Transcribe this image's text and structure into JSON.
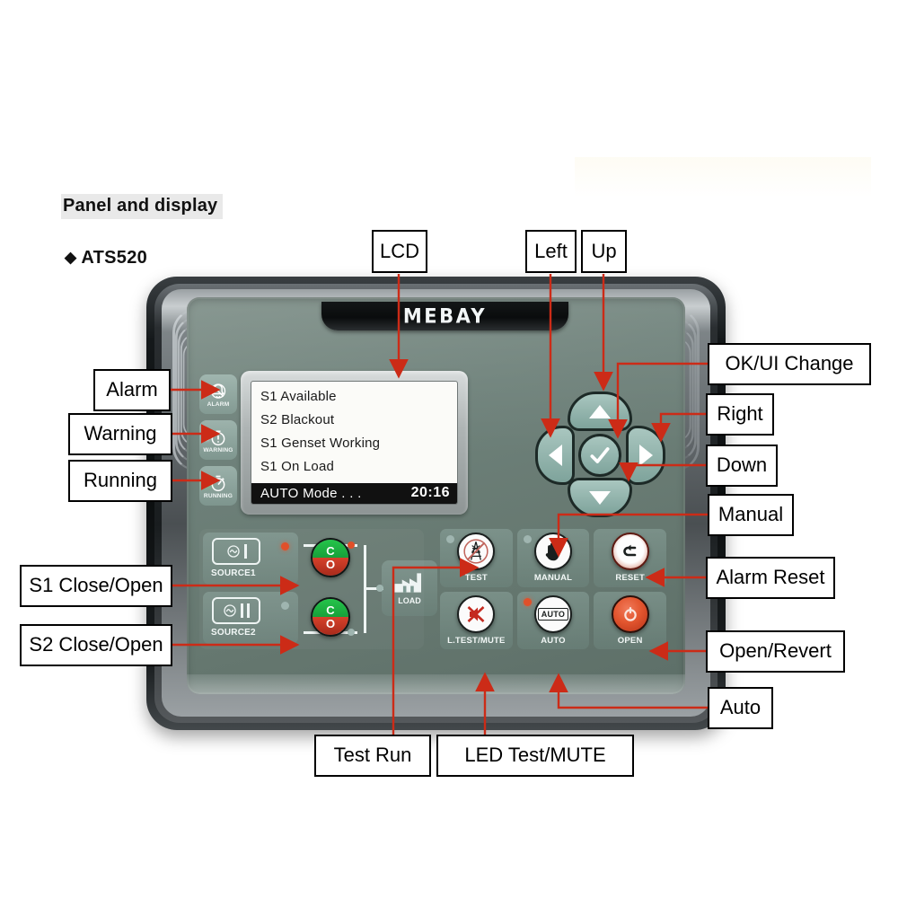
{
  "page": {
    "section_title": "Panel and display",
    "model_bullet": "◆",
    "model_name": "ATS520"
  },
  "device": {
    "brand": "MEBAY",
    "lcd": {
      "lines": [
        "S1 Available",
        "S2 Blackout",
        "S1 Genset Working",
        "S1 On Load"
      ],
      "status_mode": "AUTO Mode . . .",
      "status_time": "20:16"
    },
    "indicators": [
      {
        "label": "ALARM",
        "icon": "alarm-bell-slash-icon",
        "state": "off"
      },
      {
        "label": "WARNING",
        "icon": "warning-exclamation-icon",
        "state": "off"
      },
      {
        "label": "RUNNING",
        "icon": "running-timer-icon",
        "state": "on"
      }
    ],
    "navpad": {
      "up": "▲",
      "down": "▼",
      "left": "◀",
      "right": "▶",
      "ok": "✓"
    },
    "sources": [
      {
        "label": "SOURCE1",
        "symbol": "ac-source-one-icon",
        "led": "red",
        "close_label": "C",
        "open_label": "O"
      },
      {
        "label": "SOURCE2",
        "symbol": "ac-source-two-icon",
        "led": "off",
        "close_label": "C",
        "open_label": "O"
      }
    ],
    "load": {
      "label": "LOAD",
      "icon": "factory-load-icon"
    },
    "buttons": [
      {
        "label": "TEST",
        "icon": "power-tower-slash-icon",
        "indicator": "off",
        "style": "white"
      },
      {
        "label": "MANUAL",
        "icon": "hand-icon",
        "indicator": "off",
        "style": "white"
      },
      {
        "label": "RESET",
        "icon": "return-arrow-icon",
        "indicator": "none",
        "style": "reset"
      },
      {
        "label": "L.TEST/MUTE",
        "icon": "speaker-mute-icon",
        "indicator": "none",
        "style": "white"
      },
      {
        "label": "AUTO",
        "icon": "auto-box-icon",
        "indicator": "red",
        "style": "white"
      },
      {
        "label": "OPEN",
        "icon": "open-power-icon",
        "indicator": "none",
        "style": "open"
      }
    ]
  },
  "callouts": {
    "lcd": "LCD",
    "left": "Left",
    "up": "Up",
    "ok_ui_change": "OK/UI Change",
    "right": "Right",
    "down": "Down",
    "manual": "Manual",
    "alarm_reset": "Alarm Reset",
    "open_revert": "Open/Revert",
    "auto": "Auto",
    "alarm": "Alarm",
    "warning": "Warning",
    "running": "Running",
    "s1_close_open": "S1 Close/Open",
    "s2_close_open": "S2 Close/Open",
    "test_run": "Test Run",
    "led_test_mute": "LED Test/MUTE"
  },
  "colors": {
    "accent_red": "#cc2b17",
    "panel": "#6e817a",
    "tile": "#8fb5ad",
    "led_green": "#64e264",
    "led_red": "#e0502a"
  }
}
